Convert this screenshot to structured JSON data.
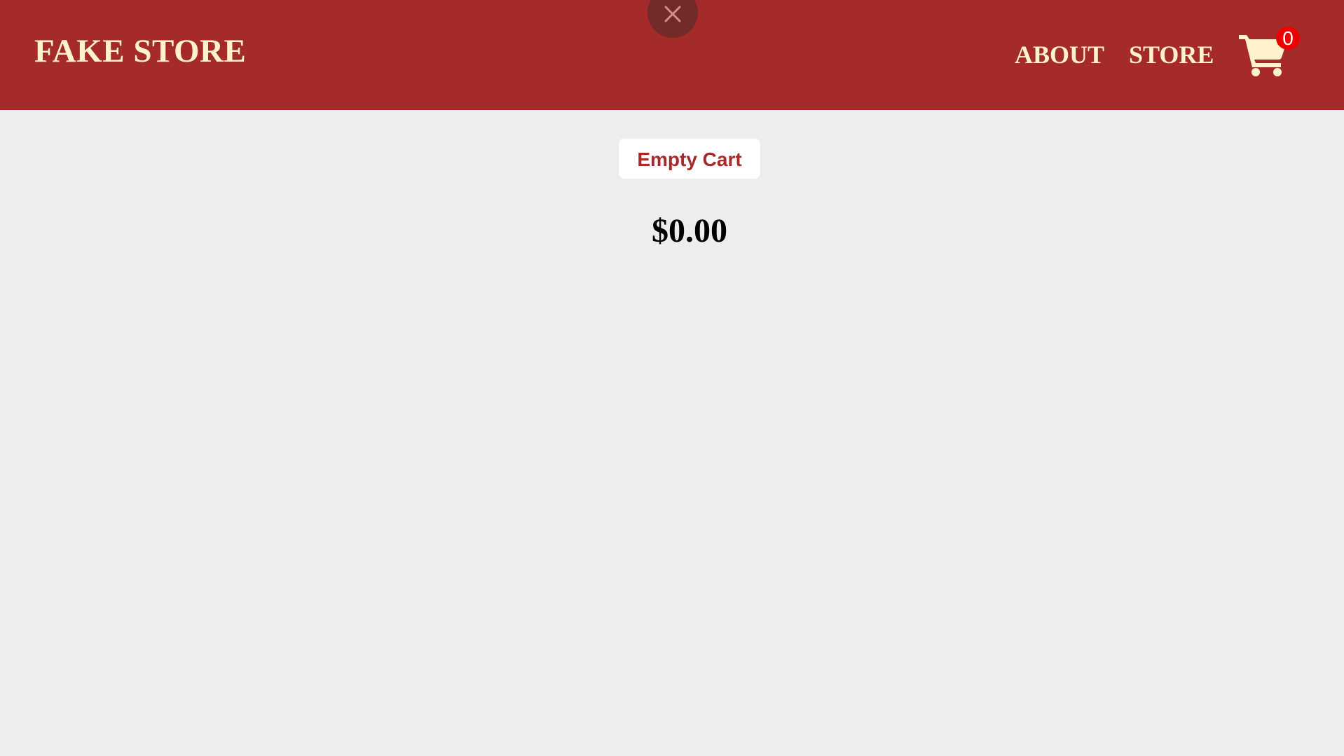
{
  "header": {
    "brand": "FAKE STORE",
    "nav": {
      "about_label": "ABOUT",
      "store_label": "STORE"
    },
    "cart": {
      "icon": "shopping-cart-icon",
      "count": "0"
    },
    "close_icon": "close-icon"
  },
  "cart_panel": {
    "empty_cart_label": "Empty Cart",
    "total": "$0.00"
  },
  "colors": {
    "header_bg": "#a52a2a",
    "header_text": "#fff2cc",
    "page_bg": "#ededed",
    "badge_bg": "#ee0000",
    "close_bg": "#722a2a"
  }
}
